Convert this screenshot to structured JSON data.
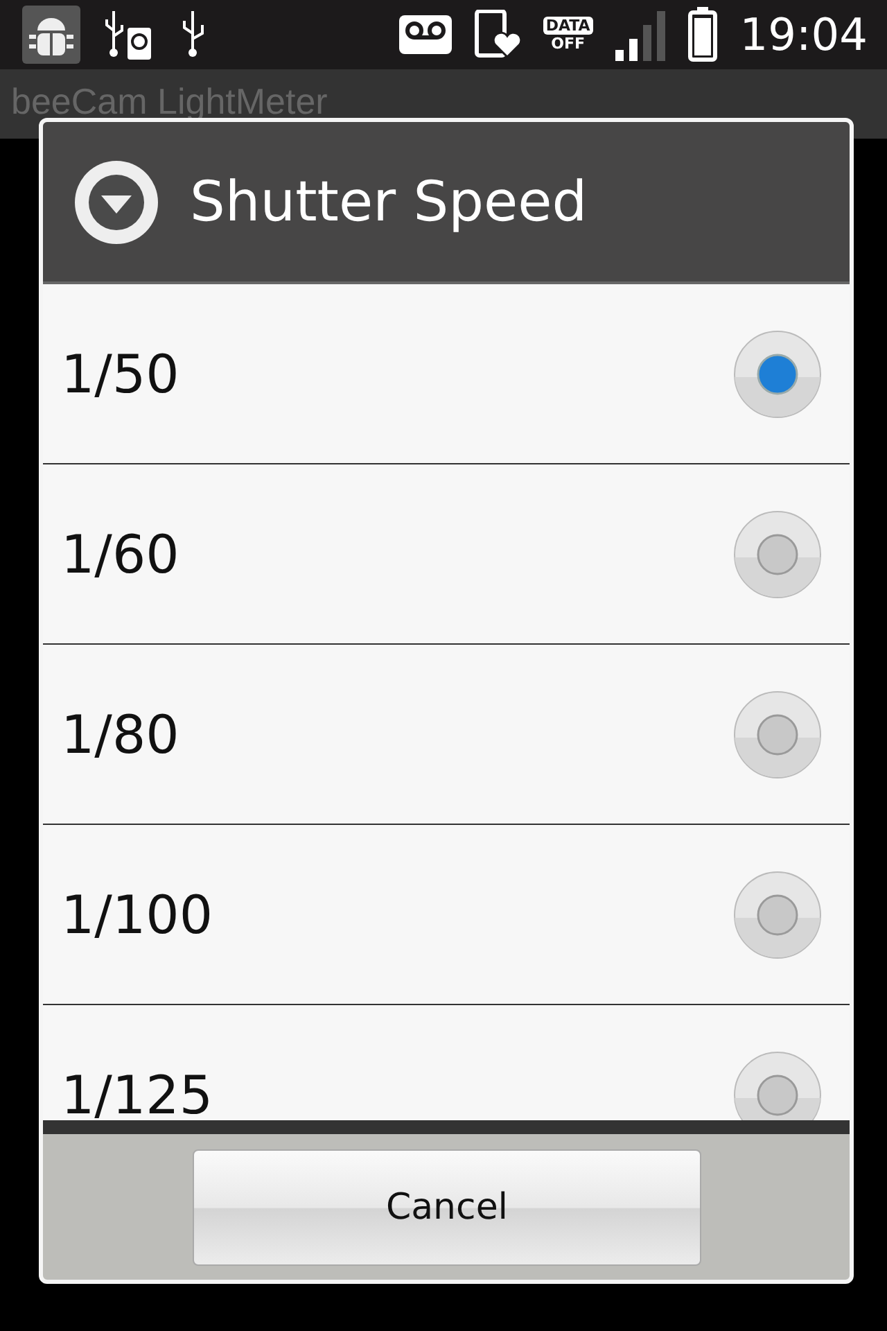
{
  "status_bar": {
    "time": "19:04",
    "data_badge": "DATA",
    "data_state": "OFF"
  },
  "app": {
    "title": "beeCam LightMeter"
  },
  "dialog": {
    "title": "Shutter Speed",
    "options": [
      {
        "label": "1/50",
        "selected": true
      },
      {
        "label": "1/60",
        "selected": false
      },
      {
        "label": "1/80",
        "selected": false
      },
      {
        "label": "1/100",
        "selected": false
      },
      {
        "label": "1/125",
        "selected": false
      }
    ],
    "cancel": "Cancel"
  }
}
